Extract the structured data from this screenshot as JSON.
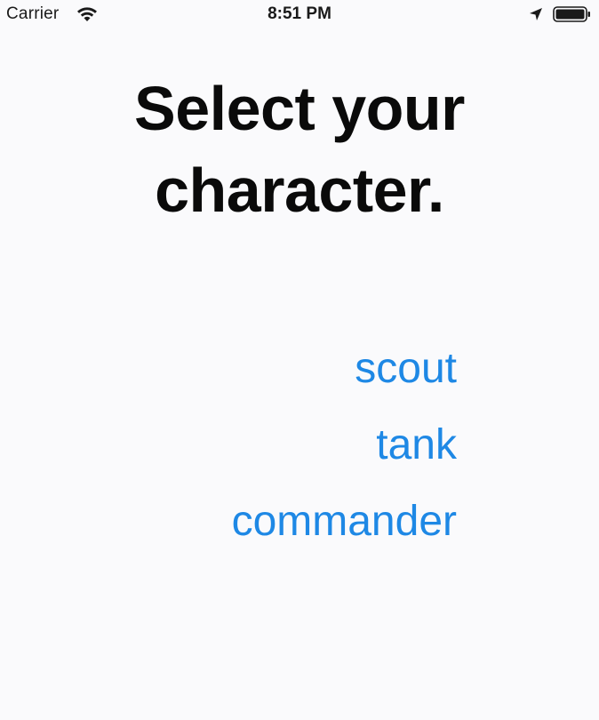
{
  "status_bar": {
    "carrier": "Carrier",
    "time": "8:51 PM",
    "icons": [
      "wifi-icon",
      "location-arrow-icon",
      "battery-icon"
    ]
  },
  "title": {
    "line1": "Select your",
    "line2": "character."
  },
  "characters": [
    {
      "label": "scout"
    },
    {
      "label": "tank"
    },
    {
      "label": "commander"
    }
  ],
  "colors": {
    "background": "#fafafc",
    "title": "#0a0a0a",
    "accent": "#1e88e5"
  }
}
